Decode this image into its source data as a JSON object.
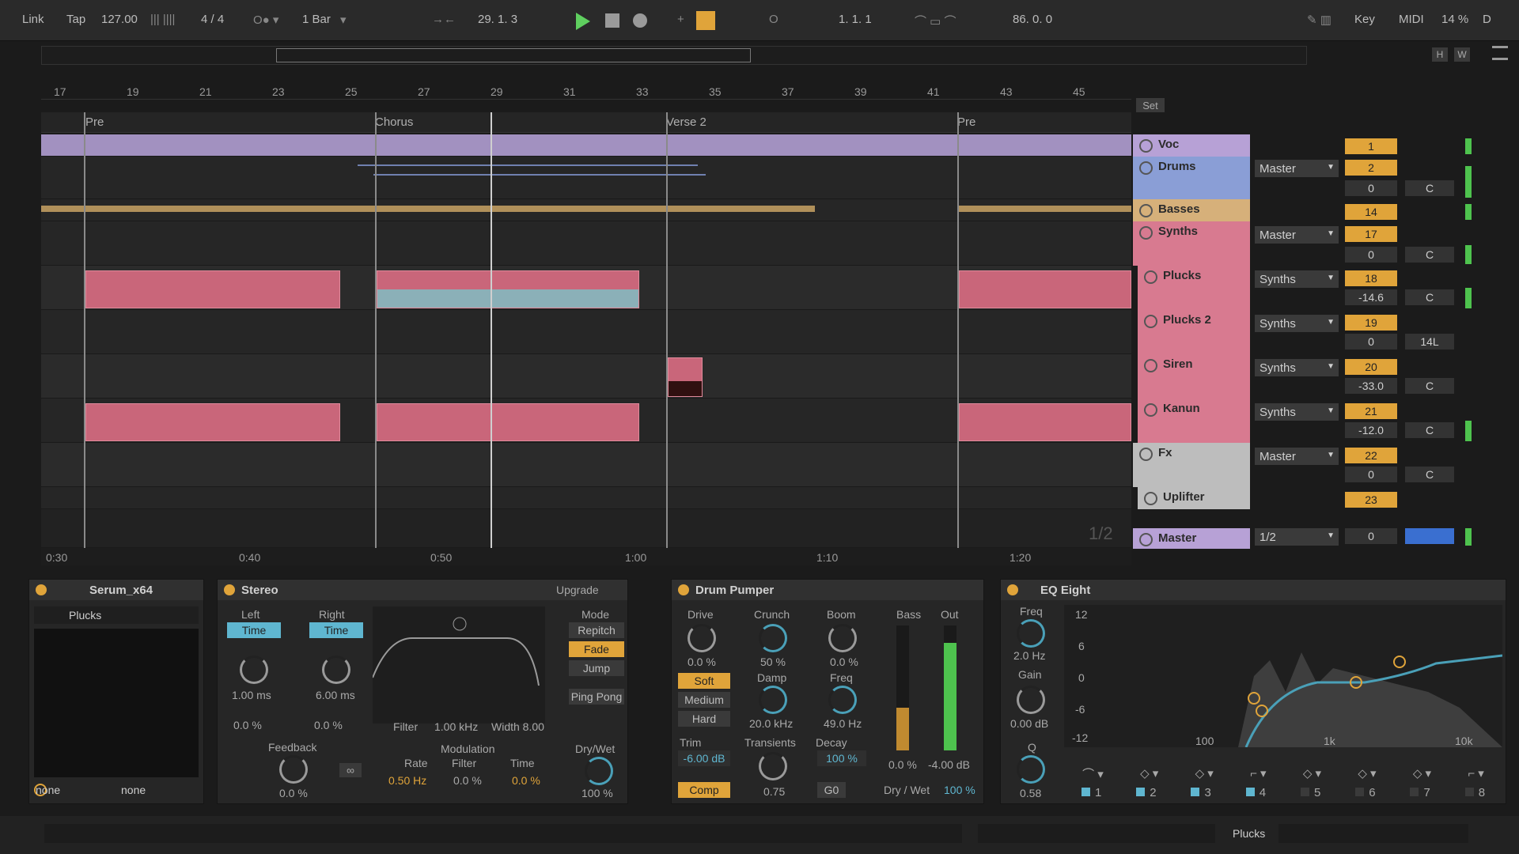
{
  "transport": {
    "link": "Link",
    "tap": "Tap",
    "tempo": "127.00",
    "signature": "4 / 4",
    "quantize": "1 Bar",
    "position": "29.   1.   3",
    "loop_start": "1.   1.   1",
    "loop_length": "86.   0.   0",
    "key": "Key",
    "midi": "MIDI",
    "cpu": "14 %",
    "d": "D"
  },
  "ruler": {
    "bars": [
      "17",
      "19",
      "21",
      "23",
      "25",
      "27",
      "29",
      "31",
      "33",
      "35",
      "37",
      "39",
      "41",
      "43",
      "45"
    ],
    "times": [
      "0:30",
      "0:40",
      "0:50",
      "1:00",
      "1:10",
      "1:20"
    ],
    "page": "1/2"
  },
  "locators": [
    "Pre",
    "Chorus",
    "Verse 2",
    "Pre"
  ],
  "set_label": "Set",
  "tracks": [
    {
      "name": "Voc",
      "color": "#b7a1d6",
      "number": "1",
      "route": "",
      "volume": "",
      "pan": ""
    },
    {
      "name": "Drums",
      "color": "#8a9ed6",
      "number": "2",
      "route": "Master",
      "volume": "0",
      "pan": "C"
    },
    {
      "name": "Basses",
      "color": "#d6b07a",
      "number": "14",
      "route": "",
      "volume": "",
      "pan": ""
    },
    {
      "name": "Synths",
      "color": "#d87a90",
      "number": "17",
      "route": "Master",
      "volume": "0",
      "pan": "C"
    },
    {
      "name": "Plucks",
      "color": "#d87a90",
      "number": "18",
      "route": "Synths",
      "volume": "-14.6",
      "pan": "C"
    },
    {
      "name": "Plucks 2",
      "color": "#d87a90",
      "number": "19",
      "route": "Synths",
      "volume": "0",
      "pan": "14L"
    },
    {
      "name": "Siren",
      "color": "#d87a90",
      "number": "20",
      "route": "Synths",
      "volume": "-33.0",
      "pan": "C"
    },
    {
      "name": "Kanun",
      "color": "#d87a90",
      "number": "21",
      "route": "Synths",
      "volume": "-12.0",
      "pan": "C"
    },
    {
      "name": "Fx",
      "color": "#bdbdbd",
      "number": "22",
      "route": "Master",
      "volume": "0",
      "pan": "C"
    },
    {
      "name": "Uplifter",
      "color": "#bdbdbd",
      "number": "23",
      "route": "",
      "volume": "",
      "pan": ""
    },
    {
      "name": "Master",
      "color": "#b7a1d6",
      "number": "0",
      "route": "1/2",
      "volume": "0",
      "pan": ""
    }
  ],
  "devices": {
    "serum": {
      "title": "Serum_x64",
      "preset": "Plucks",
      "in1": "none",
      "in2": "none"
    },
    "stereo": {
      "title": "Stereo",
      "upgrade": "Upgrade",
      "left": "Left",
      "right": "Right",
      "time": "Time",
      "left_ms": "1.00 ms",
      "right_ms": "6.00 ms",
      "left_pct": "0.0 %",
      "right_pct": "0.0 %",
      "feedback": "Feedback",
      "feedback_val": "0.0 %",
      "filter": "Filter",
      "filter_val": "1.00 kHz",
      "width": "Width 8.00",
      "modulation": "Modulation",
      "rate": "Rate",
      "mfilter": "Filter",
      "mtime": "Time",
      "rate_val": "0.50 Hz",
      "mfilter_val": "0.0 %",
      "mtime_val": "0.0 %",
      "mode": "Mode",
      "repitch": "Repitch",
      "fade": "Fade",
      "jump": "Jump",
      "pingpong": "Ping Pong",
      "drywet": "Dry/Wet",
      "drywet_val": "100 %"
    },
    "pumper": {
      "title": "Drum Pumper",
      "drive": "Drive",
      "drive_val": "0.0 %",
      "crunch": "Crunch",
      "crunch_val": "50 %",
      "boom": "Boom",
      "boom_val": "0.0 %",
      "soft": "Soft",
      "medium": "Medium",
      "hard": "Hard",
      "damp": "Damp",
      "damp_val": "20.0 kHz",
      "freq": "Freq",
      "freq_val": "49.0 Hz",
      "trim": "Trim",
      "trim_val": "-6.00 dB",
      "transients": "Transients",
      "trans_val": "0.75",
      "decay": "Decay",
      "decay_val": "100 %",
      "comp": "Comp",
      "go": "G0",
      "bass": "Bass",
      "out": "Out",
      "bass_val": "0.0 %",
      "out_val": "-4.00 dB",
      "drywet": "Dry / Wet",
      "drywet_val": "100 %"
    },
    "eq": {
      "title": "EQ Eight",
      "freq": "Freq",
      "freq_val": "2.0 Hz",
      "gain": "Gain",
      "gain_val": "0.00 dB",
      "q": "Q",
      "q_val": "0.58",
      "db_labels": [
        "12",
        "6",
        "0",
        "-6",
        "-12"
      ],
      "hz_labels": [
        "100",
        "1k",
        "10k"
      ],
      "bands": [
        "1",
        "2",
        "3",
        "4",
        "5",
        "6",
        "7",
        "8"
      ]
    }
  },
  "footer": {
    "track": "Plucks"
  }
}
